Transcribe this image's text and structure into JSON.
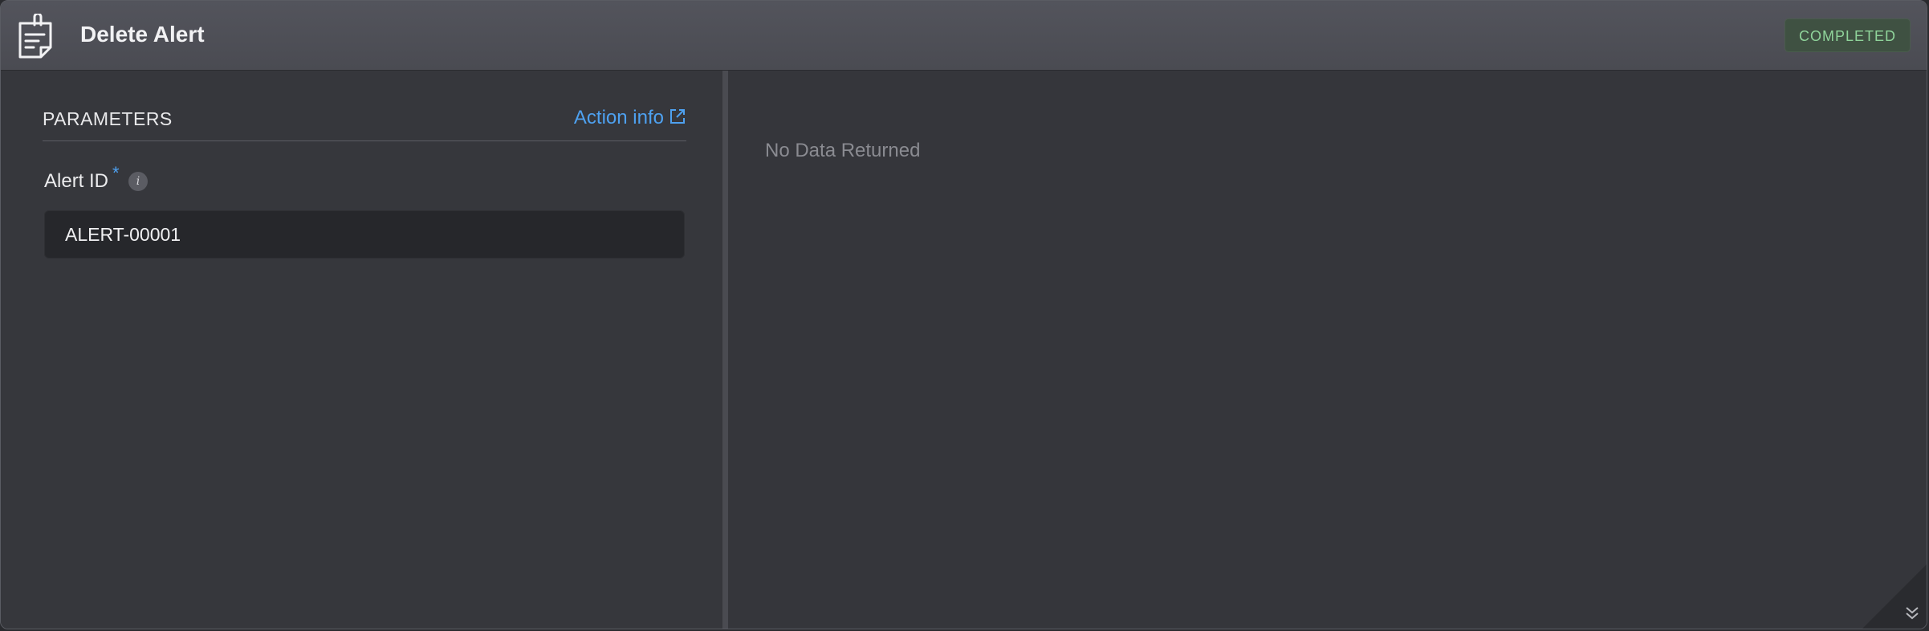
{
  "header": {
    "title": "Delete Alert",
    "status": "COMPLETED",
    "icon": "clipboard-note-icon",
    "status_color": "#8fd39a"
  },
  "parameters": {
    "section_title": "PARAMETERS",
    "action_info_label": "Action info",
    "action_info_icon": "external-link-icon",
    "link_color": "#4ea1f0",
    "fields": [
      {
        "label": "Alert ID",
        "required_marker": "*",
        "info_icon_glyph": "i",
        "value": "ALERT-00001"
      }
    ]
  },
  "result": {
    "message": "No Data Returned"
  },
  "corner": {
    "icon": "chevrons-down-icon"
  }
}
